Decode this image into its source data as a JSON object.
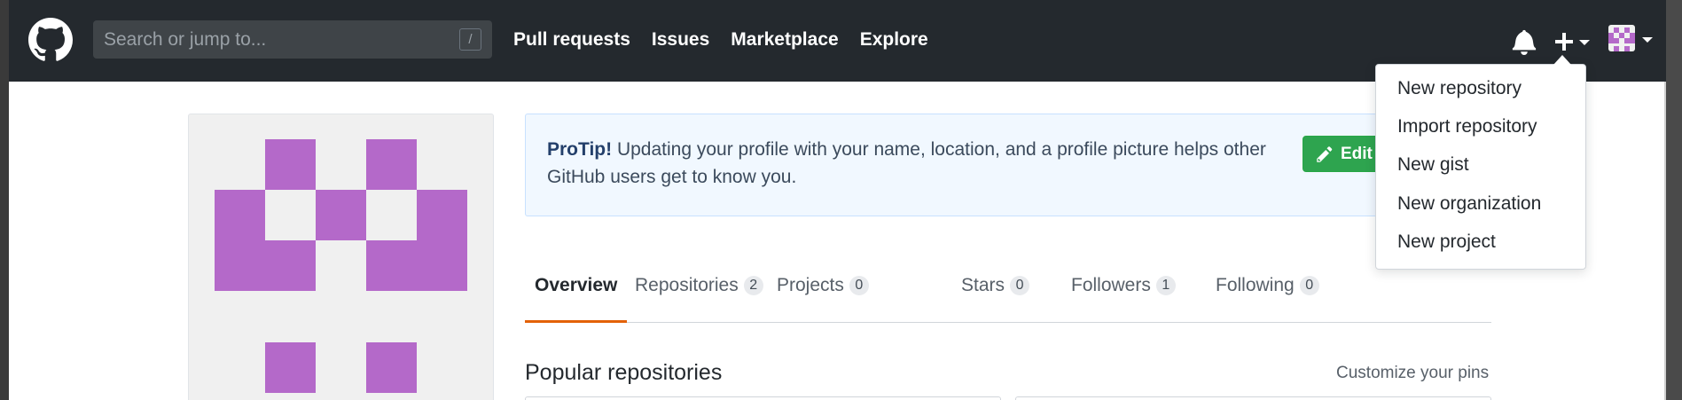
{
  "header": {
    "search_placeholder": "Search or jump to...",
    "search_hint": "/",
    "nav": [
      "Pull requests",
      "Issues",
      "Marketplace",
      "Explore"
    ]
  },
  "icons": {
    "logo": "github-octocat-icon",
    "notifications": "bell-icon",
    "create": "plus-icon",
    "edit": "pencil-icon"
  },
  "create_menu": {
    "items": [
      "New repository",
      "Import repository",
      "New gist",
      "New organization",
      "New project"
    ]
  },
  "protip": {
    "label": "ProTip!",
    "message": " Updating your profile with your name, location, and a profile picture helps other GitHub users get to know you.",
    "button": "Edit profile"
  },
  "tabs": [
    {
      "label": "Overview",
      "count": null
    },
    {
      "label": "Repositories",
      "count": "2"
    },
    {
      "label": "Projects",
      "count": "0"
    },
    {
      "label": "Stars",
      "count": "0"
    },
    {
      "label": "Followers",
      "count": "1"
    },
    {
      "label": "Following",
      "count": "0"
    }
  ],
  "main": {
    "section_title": "Popular repositories",
    "customize_link": "Customize your pins"
  },
  "colors": {
    "header_bg": "#24292e",
    "identicon": "#b469c9",
    "active_tab_underline": "#e36209",
    "edit_button": "#2ea44f"
  }
}
